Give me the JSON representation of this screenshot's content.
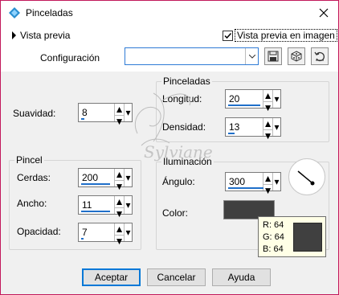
{
  "window": {
    "title": "Pinceladas"
  },
  "preview": {
    "toggle_label": "Vista previa",
    "live_label": "Vista previa en imagen",
    "live_checked": true
  },
  "config": {
    "label": "Configuración",
    "value": ""
  },
  "brush": {
    "smoothness_label": "Suavidad:",
    "smoothness_value": "8",
    "group_title": "Pincel",
    "bristles_label": "Cerdas:",
    "bristles_value": "200",
    "width_label": "Ancho:",
    "width_value": "11",
    "opacity_label": "Opacidad:",
    "opacity_value": "7"
  },
  "strokes": {
    "group_title": "Pinceladas",
    "length_label": "Longitud:",
    "length_value": "20",
    "density_label": "Densidad:",
    "density_value": "13"
  },
  "lighting": {
    "group_title": "Iluminación",
    "angle_label": "Ángulo:",
    "angle_value": "300",
    "color_label": "Color:",
    "color_hex": "#404040"
  },
  "tooltip": {
    "r": "R: 64",
    "g": "G: 64",
    "b": "B: 64"
  },
  "watermark": {
    "text": "Sylviane"
  },
  "buttons": {
    "ok": "Aceptar",
    "cancel": "Cancelar",
    "help": "Ayuda"
  }
}
